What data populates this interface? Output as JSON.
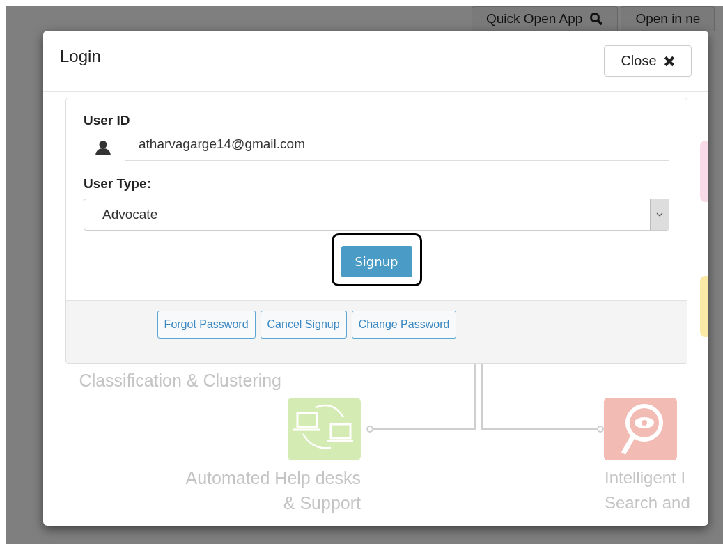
{
  "top_bar": {
    "buttons": [
      {
        "label": "Quick Open App"
      },
      {
        "label": "Open in ne"
      }
    ]
  },
  "dialog": {
    "title": "Login",
    "close_button": "Close"
  },
  "login_form": {
    "user_id_label": "User ID",
    "user_id_value": "atharvagarge14@gmail.com",
    "user_type_label": "User Type:",
    "user_type_value": "Advocate",
    "submit_button": {
      "label": "Signup",
      "focused": true
    },
    "footer_buttons": [
      "Forgot Password",
      "Cancel Signup",
      "Change Password"
    ]
  },
  "background_diagram": {
    "texts": [
      {
        "kind": "right",
        "lines": [
          "Classification & Clustering"
        ]
      },
      {
        "kind": "right",
        "lines": [
          "Automated Help desks",
          "& Support"
        ]
      },
      {
        "kind": "left",
        "lines": [
          "Intelligent I",
          "Search and"
        ]
      }
    ]
  }
}
